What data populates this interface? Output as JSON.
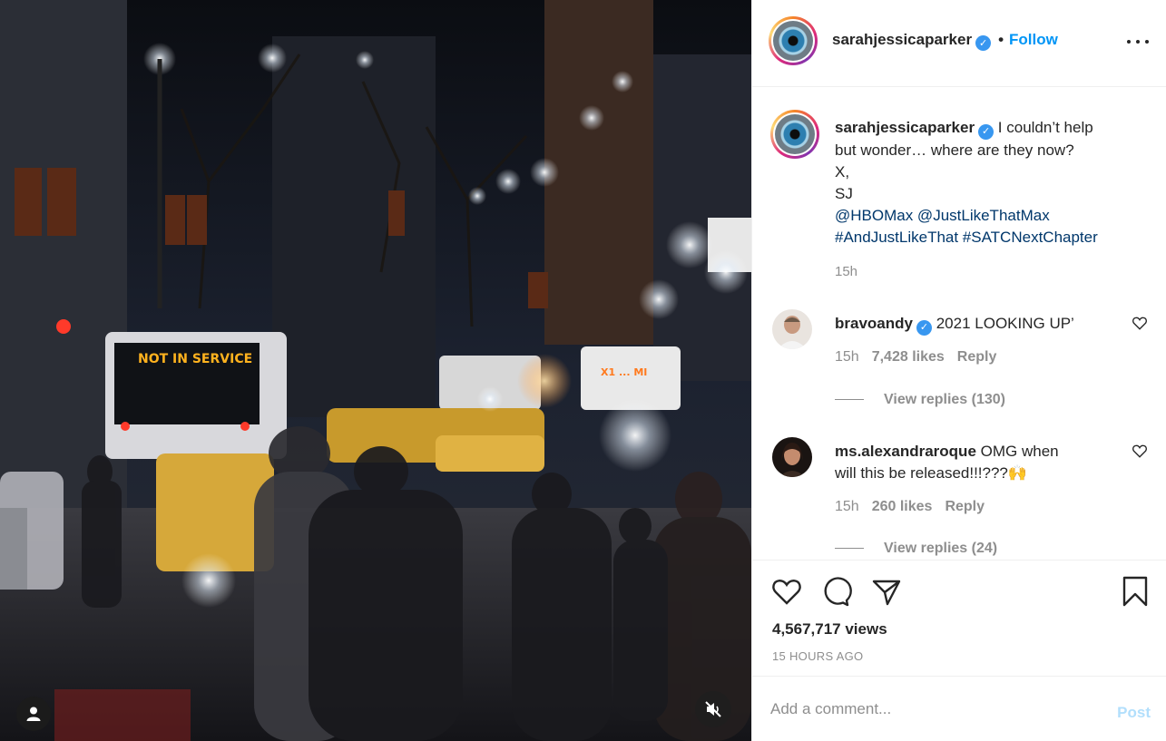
{
  "post": {
    "author": "sarahjessicaparker",
    "follow_label": "Follow",
    "dot": "•",
    "verified_glyph": "✓"
  },
  "caption": {
    "author": "sarahjessicaparker",
    "line1": "I couldn’t help",
    "line2": "but wonder… where are they now?",
    "line3": "X,",
    "line4": "SJ",
    "mentions": "@HBOMax @JustLikeThatMax",
    "hashtags": "#AndJustLikeThat #SATCNextChapter",
    "time": "15h"
  },
  "comments": [
    {
      "author": "bravoandy",
      "text": "2021 LOOKING UP’",
      "time": "15h",
      "likes": "7,428 likes",
      "reply_label": "Reply",
      "view_replies": "View replies (130)"
    },
    {
      "author": "ms.alexandraroque",
      "text_line1": "OMG when",
      "text_line2": "will this be released!!!???🙌",
      "time": "15h",
      "likes": "260 likes",
      "reply_label": "Reply",
      "view_replies": "View replies (24)"
    }
  ],
  "media": {
    "bus_sign": "NOT IN SERVICE"
  },
  "actions": {
    "views": "4,567,717 views",
    "posted": "15 HOURS AGO",
    "icons": [
      "heart-icon",
      "comment-icon",
      "share-icon",
      "bookmark-icon"
    ]
  },
  "composer": {
    "placeholder": "Add a comment...",
    "post_label": "Post"
  },
  "colors": {
    "accent": "#0095f6",
    "link": "#00376b",
    "muted": "#8e8e8e",
    "post_disabled": "#b2dffc"
  }
}
